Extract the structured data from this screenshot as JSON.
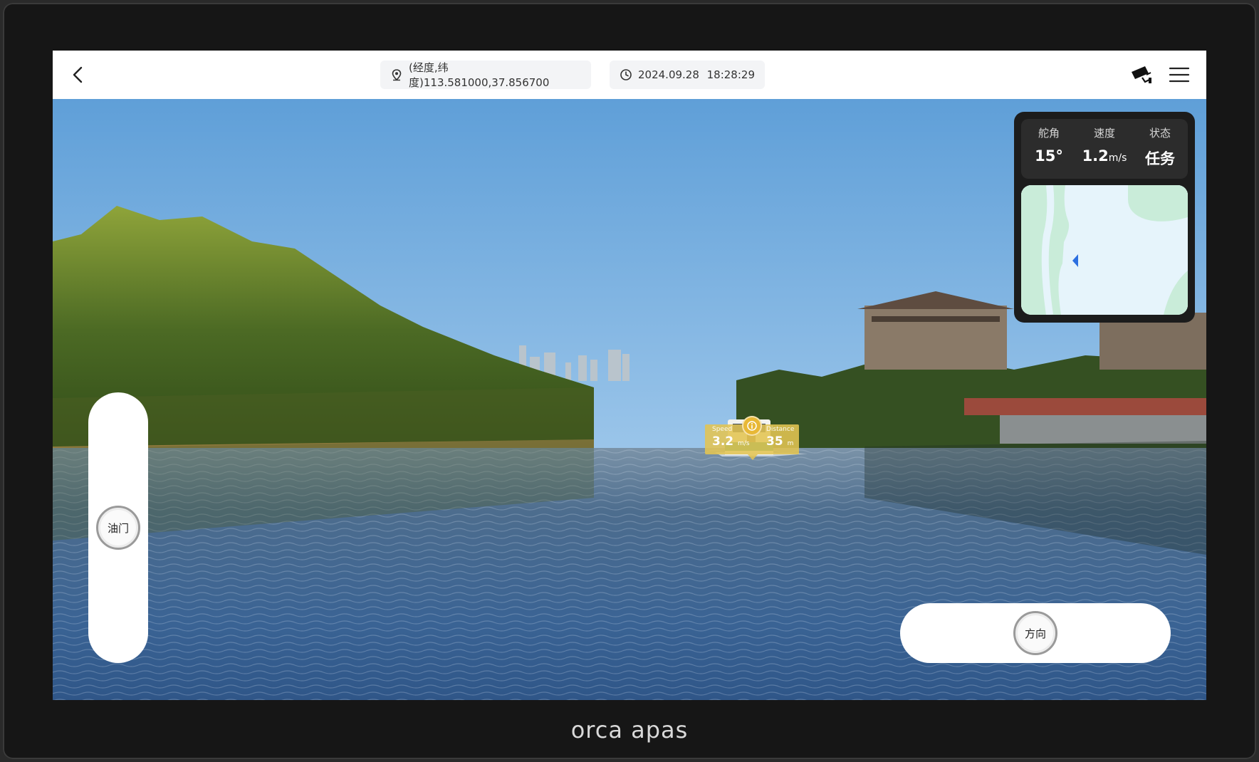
{
  "header": {
    "coords_text": "(经度,纬度)113.581000,37.856700",
    "date": "2024.09.28",
    "time": "18:28:29"
  },
  "telemetry": {
    "rudder": {
      "label": "舵角",
      "value": "15°",
      "unit": ""
    },
    "speed": {
      "label": "速度",
      "value": "1.2",
      "unit": "m/s"
    },
    "status": {
      "label": "状态",
      "value": "任务"
    }
  },
  "ar_tag": {
    "speed": {
      "label": "Speed",
      "value": "3.2",
      "unit": "m/s"
    },
    "distance": {
      "label": "Distance",
      "value": "35",
      "unit": "m"
    }
  },
  "controls": {
    "throttle_label": "油门",
    "direction_label": "方向"
  },
  "brand": "orca apas",
  "icons": [
    "chevron-left-icon",
    "location-pin-icon",
    "clock-icon",
    "camera-icon",
    "menu-icon",
    "boat-marker-icon",
    "info-icon"
  ]
}
